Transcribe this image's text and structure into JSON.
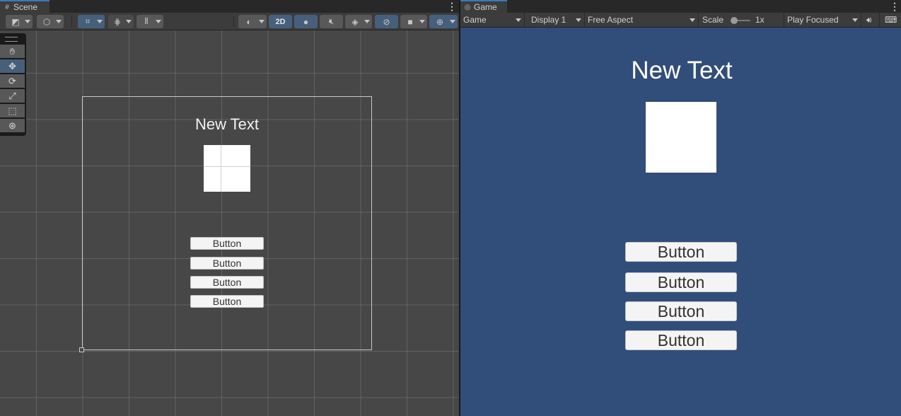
{
  "scene": {
    "tab_label": "Scene",
    "tab_icon": "scene-grid-icon",
    "toolbar": {
      "mode_2d_label": "2D",
      "icons": [
        "draw-mode-icon",
        "cube-gizmo-icon",
        "snap-grid-icon",
        "grid-icon",
        "ruler-icon",
        "shading-sphere-icon",
        "light-bulb-icon",
        "audio-mute-icon",
        "effects-layers-icon",
        "hidden-eye-icon",
        "camera-icon",
        "gizmos-icon"
      ]
    },
    "tools": [
      "hand-tool",
      "move-tool",
      "rotate-tool",
      "scale-tool",
      "rect-tool",
      "transform-tool"
    ],
    "active_tool": "move-tool",
    "text_label": "New Text",
    "buttons": [
      "Button",
      "Button",
      "Button",
      "Button"
    ]
  },
  "game": {
    "tab_label": "Game",
    "tab_icon": "gamepad-icon",
    "toolbar": {
      "view_label": "Game",
      "display_label": "Display 1",
      "aspect_label": "Free Aspect",
      "scale_label": "Scale",
      "scale_value": "1x",
      "play_mode_label": "Play Focused"
    },
    "background_color": "#314d79",
    "text_label": "New Text",
    "buttons": [
      "Button",
      "Button",
      "Button",
      "Button"
    ]
  }
}
